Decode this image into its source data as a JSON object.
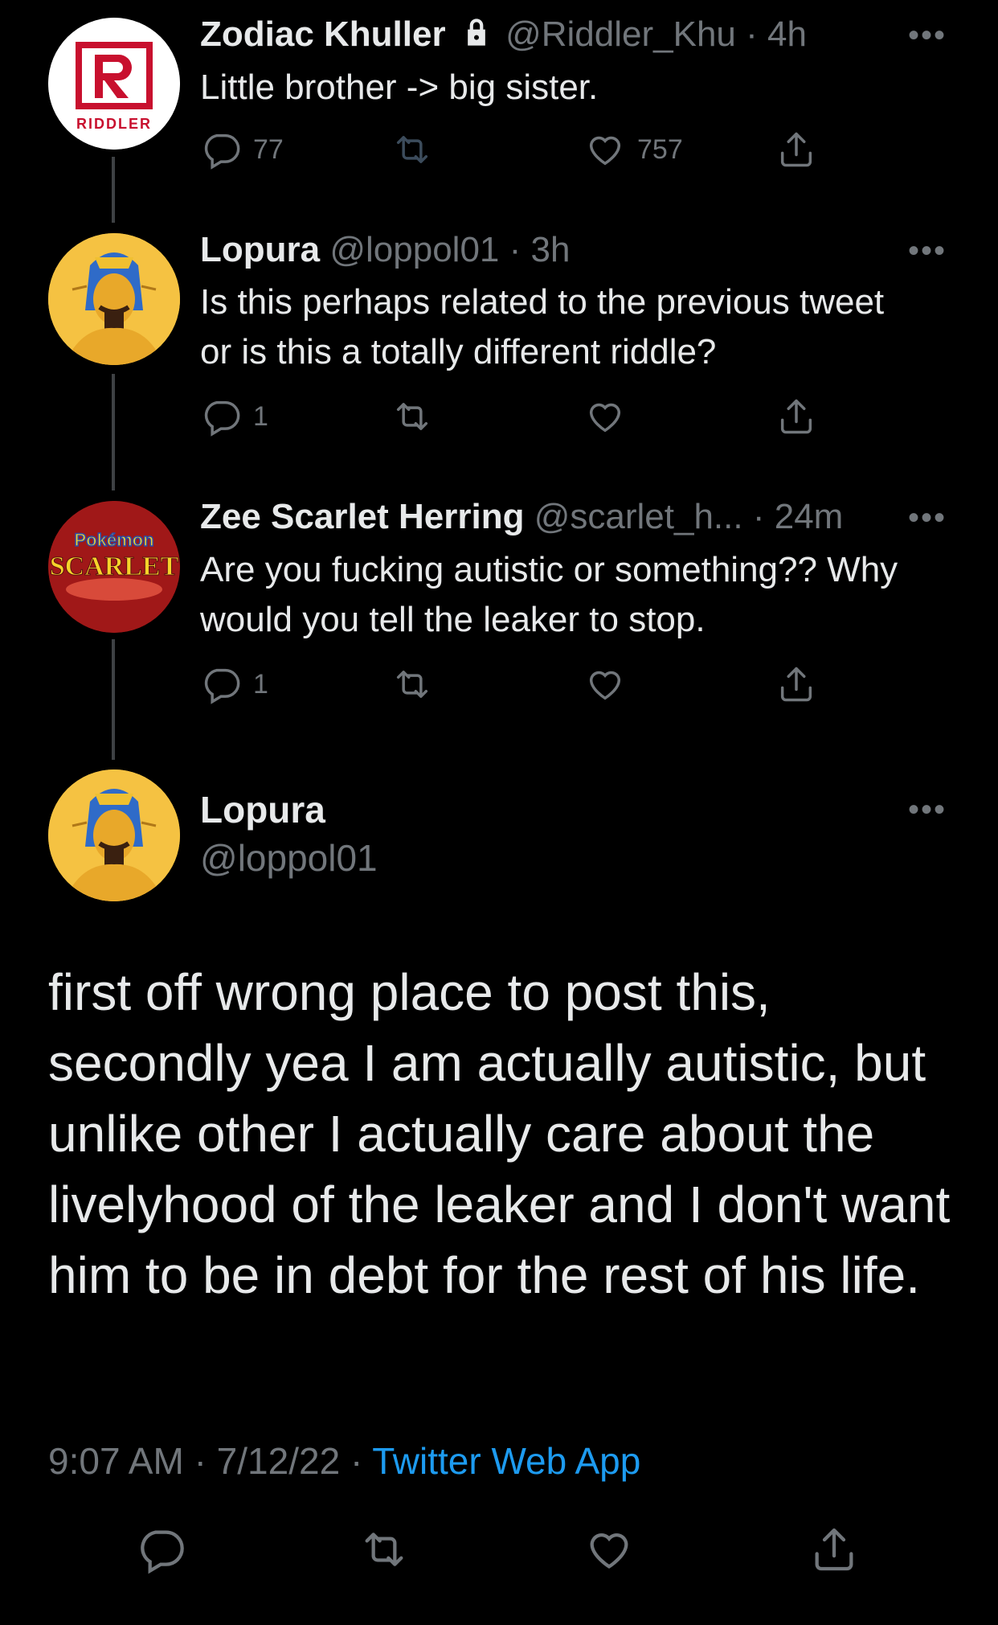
{
  "tweets": [
    {
      "name": "Zodiac Khuller",
      "handle": "@Riddler_Khu",
      "time": "4h",
      "text": "Little brother -> big sister.",
      "replies": "77",
      "retweets": "",
      "likes": "757",
      "locked": true,
      "avatar_text": "RIDDLER"
    },
    {
      "name": "Lopura",
      "handle": "@loppol01",
      "time": "3h",
      "text": "Is this perhaps related to the previous tweet or is this a totally different riddle?",
      "replies": "1",
      "retweets": "",
      "likes": ""
    },
    {
      "name": "Zee Scarlet Herring",
      "handle": "@scarlet_h...",
      "time": "24m",
      "text": "Are you fucking autistic or something?? Why would you tell the leaker to stop.",
      "replies": "1",
      "retweets": "",
      "likes": "",
      "avatar_text_top": "Pokémon",
      "avatar_text_bottom": "SCARLET"
    }
  ],
  "main_tweet": {
    "name": "Lopura",
    "handle": "@loppol01",
    "text": "first off wrong place to post this, secondly yea I am actually autistic, but unlike other I actually care about the livelyhood of the leaker and I don't want him to be in debt for the rest of his life.",
    "time": "9:07 AM",
    "date": "7/12/22",
    "source": "Twitter Web App",
    "separator": "·"
  },
  "more_glyph": "•••",
  "colors": {
    "background": "#000000",
    "text": "#e7e9ea",
    "muted": "#71767b",
    "link": "#1d9bf0",
    "thread_line": "#3e4144"
  }
}
